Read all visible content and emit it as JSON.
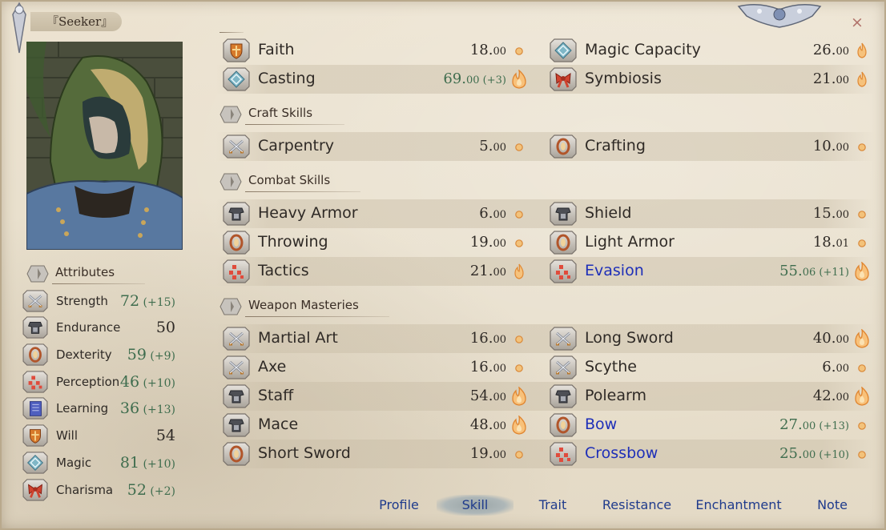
{
  "character": {
    "name": "『Seeker』"
  },
  "colors": {
    "blue_text": "#1e2fb8",
    "green_value": "#3f6d4e",
    "tab_text": "#1f3b8c"
  },
  "sections": {
    "craft": "Craft Skills",
    "combat": "Combat Skills",
    "weapon": "Weapon Masteries",
    "attributes": "Attributes"
  },
  "skills": [
    {
      "name": "Faith",
      "base": "18.",
      "frac": "00",
      "bonus": "",
      "icon": "will-shield-icon",
      "potential": "small-flame"
    },
    {
      "name": "Magic Capacity",
      "base": "26.",
      "frac": "00",
      "bonus": "",
      "icon": "magic-diamond-icon",
      "potential": "flame"
    },
    {
      "name": "Casting",
      "base": "69.",
      "frac": "00",
      "bonus": " (+3)",
      "icon": "magic-diamond-icon",
      "potential": "big-flame"
    },
    {
      "name": "Symbiosis",
      "base": "21.",
      "frac": "00",
      "bonus": "",
      "icon": "charisma-ribbon-icon",
      "potential": "flame"
    },
    {
      "name": "Carpentry",
      "base": "5.",
      "frac": "00",
      "bonus": "",
      "icon": "crossed-swords-icon",
      "potential": "small-flame"
    },
    {
      "name": "Crafting",
      "base": "10.",
      "frac": "00",
      "bonus": "",
      "icon": "dexterity-ring-icon",
      "potential": "small-flame"
    },
    {
      "name": "Heavy Armor",
      "base": "6.",
      "frac": "00",
      "bonus": "",
      "icon": "armor-icon",
      "potential": "small-flame"
    },
    {
      "name": "Shield",
      "base": "15.",
      "frac": "00",
      "bonus": "",
      "icon": "armor-icon",
      "potential": "small-flame"
    },
    {
      "name": "Throwing",
      "base": "19.",
      "frac": "00",
      "bonus": "",
      "icon": "dexterity-ring-icon",
      "potential": "small-flame"
    },
    {
      "name": "Light Armor",
      "base": "18.",
      "frac": "01",
      "bonus": "",
      "icon": "dexterity-ring-icon",
      "potential": "small-flame"
    },
    {
      "name": "Tactics",
      "base": "21.",
      "frac": "00",
      "bonus": "",
      "icon": "perception-dots-icon",
      "potential": "flame"
    },
    {
      "name": "Evasion",
      "base": "55.",
      "frac": "06",
      "bonus": " (+11)",
      "icon": "perception-dots-icon",
      "potential": "big-flame"
    },
    {
      "name": "Martial Art",
      "base": "16.",
      "frac": "00",
      "bonus": "",
      "icon": "crossed-swords-icon",
      "potential": "small-flame"
    },
    {
      "name": "Long Sword",
      "base": "40.",
      "frac": "00",
      "bonus": "",
      "icon": "crossed-swords-icon",
      "potential": "big-flame"
    },
    {
      "name": "Axe",
      "base": "16.",
      "frac": "00",
      "bonus": "",
      "icon": "crossed-swords-icon",
      "potential": "small-flame"
    },
    {
      "name": "Scythe",
      "base": "6.",
      "frac": "00",
      "bonus": "",
      "icon": "crossed-swords-icon",
      "potential": "small-flame"
    },
    {
      "name": "Staff",
      "base": "54.",
      "frac": "00",
      "bonus": "",
      "icon": "armor-icon",
      "potential": "big-flame"
    },
    {
      "name": "Polearm",
      "base": "42.",
      "frac": "00",
      "bonus": "",
      "icon": "armor-icon",
      "potential": "big-flame"
    },
    {
      "name": "Mace",
      "base": "48.",
      "frac": "00",
      "bonus": "",
      "icon": "armor-icon",
      "potential": "big-flame"
    },
    {
      "name": "Bow",
      "base": "27.",
      "frac": "00",
      "bonus": " (+13)",
      "icon": "dexterity-ring-icon",
      "potential": "small-flame"
    },
    {
      "name": "Short Sword",
      "base": "19.",
      "frac": "00",
      "bonus": "",
      "icon": "dexterity-ring-icon",
      "potential": "small-flame"
    },
    {
      "name": "Crossbow",
      "base": "25.",
      "frac": "00",
      "bonus": " (+10)",
      "icon": "perception-dots-icon",
      "potential": "small-flame"
    }
  ],
  "attributes": [
    {
      "name": "Strength",
      "value": "72",
      "bonus": " (+15)"
    },
    {
      "name": "Endurance",
      "value": "50",
      "bonus": ""
    },
    {
      "name": "Dexterity",
      "value": "59",
      "bonus": " (+9)"
    },
    {
      "name": "Perception",
      "value": "46",
      "bonus": " (+10)"
    },
    {
      "name": "Learning",
      "value": "36",
      "bonus": " (+13)"
    },
    {
      "name": "Will",
      "value": "54",
      "bonus": ""
    },
    {
      "name": "Magic",
      "value": "81",
      "bonus": " (+10)"
    },
    {
      "name": "Charisma",
      "value": "52",
      "bonus": " (+2)"
    }
  ],
  "tabs": [
    "Profile",
    "Skill",
    "Trait",
    "Resistance",
    "Enchantment",
    "Note"
  ],
  "active_tab": "Skill",
  "close_glyph": "×"
}
